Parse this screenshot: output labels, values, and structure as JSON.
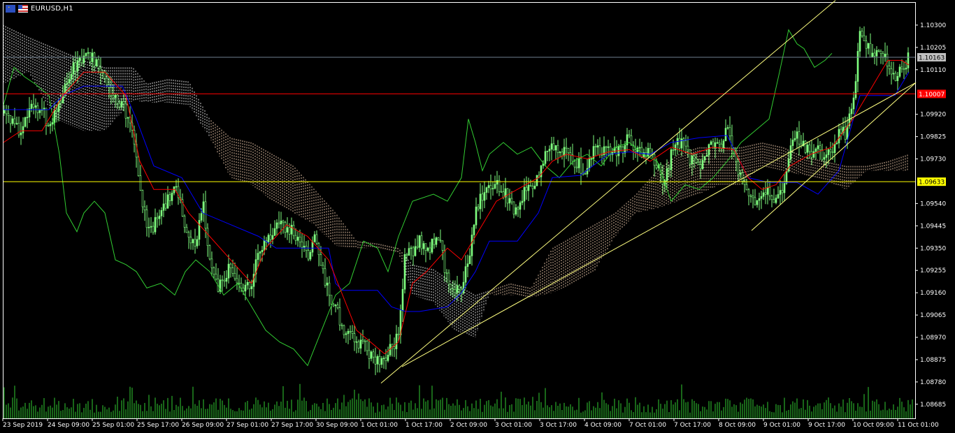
{
  "window": {
    "title": "EURUSD,H1"
  },
  "colors": {
    "background": "#000000",
    "frame": "#ffffff",
    "candles": "#7fff7f",
    "chikou": "#32cd32",
    "tenkan": "#ff0000",
    "kijun": "#0000ff",
    "cloud_bull": "#ffffff",
    "cloud_bear": "#ffdab9",
    "channel": "#ffff80",
    "volume": "#32cd32",
    "hline_bid": "#708090",
    "hline_red": "#ff0000",
    "hline_yellow": "#ffff00"
  },
  "chart_data": {
    "type": "candlestick",
    "symbol": "EURUSD",
    "timeframe": "H1",
    "ylim": [
      1.08625,
      1.10395
    ],
    "y_ticks": [
      "1.10300",
      "1.10205",
      "1.10110",
      "1.09920",
      "1.09825",
      "1.09730",
      "1.09540",
      "1.09445",
      "1.09350",
      "1.09255",
      "1.09160",
      "1.09065",
      "1.08970",
      "1.08875",
      "1.08780",
      "1.08685"
    ],
    "x_labels": [
      "23 Sep 2019",
      "24 Sep 09:00",
      "25 Sep 01:00",
      "25 Sep 17:00",
      "26 Sep 09:00",
      "27 Sep 01:00",
      "27 Sep 17:00",
      "30 Sep 09:00",
      "1 Oct 01:00",
      "1 Oct 17:00",
      "2 Oct 09:00",
      "3 Oct 01:00",
      "3 Oct 17:00",
      "4 Oct 09:00",
      "7 Oct 01:00",
      "7 Oct 17:00",
      "8 Oct 09:00",
      "9 Oct 01:00",
      "9 Oct 17:00",
      "10 Oct 09:00",
      "11 Oct 01:00"
    ],
    "close_series": [
      [
        0,
        1.0993
      ],
      [
        10,
        1.0992
      ],
      [
        20,
        1.0986
      ],
      [
        30,
        1.0985
      ],
      [
        40,
        1.0993
      ],
      [
        50,
        1.0996
      ],
      [
        60,
        1.0994
      ],
      [
        70,
        1.0987
      ],
      [
        80,
        1.0992
      ],
      [
        90,
        1.1002
      ],
      [
        100,
        1.1009
      ],
      [
        110,
        1.1014
      ],
      [
        120,
        1.1018
      ],
      [
        130,
        1.1016
      ],
      [
        140,
        1.1015
      ],
      [
        150,
        1.1008
      ],
      [
        160,
        1.1002
      ],
      [
        170,
        1.0998
      ],
      [
        180,
        1.0992
      ],
      [
        190,
        1.0983
      ],
      [
        200,
        1.0961
      ],
      [
        210,
        1.0946
      ],
      [
        220,
        1.0944
      ],
      [
        230,
        1.095
      ],
      [
        240,
        1.0955
      ],
      [
        250,
        1.0964
      ],
      [
        260,
        1.095
      ],
      [
        270,
        1.094
      ],
      [
        280,
        1.0935
      ],
      [
        290,
        1.0955
      ],
      [
        300,
        1.093
      ],
      [
        310,
        1.0918
      ],
      [
        320,
        1.092
      ],
      [
        330,
        1.0928
      ],
      [
        340,
        1.0922
      ],
      [
        350,
        1.0918
      ],
      [
        360,
        1.092
      ],
      [
        370,
        1.0932
      ],
      [
        380,
        1.0938
      ],
      [
        390,
        1.0942
      ],
      [
        400,
        1.0946
      ],
      [
        410,
        1.0942
      ],
      [
        420,
        1.0943
      ],
      [
        430,
        1.0934
      ],
      [
        440,
        1.0932
      ],
      [
        450,
        1.094
      ],
      [
        460,
        1.0928
      ],
      [
        470,
        1.0915
      ],
      [
        480,
        1.091
      ],
      [
        490,
        1.09
      ],
      [
        500,
        1.0898
      ],
      [
        510,
        1.0893
      ],
      [
        520,
        1.0894
      ],
      [
        530,
        1.089
      ],
      [
        540,
        1.0888
      ],
      [
        550,
        1.0888
      ],
      [
        560,
        1.0892
      ],
      [
        570,
        1.0897
      ],
      [
        580,
        1.0935
      ],
      [
        590,
        1.0933
      ],
      [
        600,
        1.0938
      ],
      [
        610,
        1.0932
      ],
      [
        620,
        1.0938
      ],
      [
        630,
        1.0936
      ],
      [
        640,
        1.092
      ],
      [
        650,
        1.0916
      ],
      [
        660,
        1.0918
      ],
      [
        670,
        1.093
      ],
      [
        680,
        1.095
      ],
      [
        690,
        1.0958
      ],
      [
        700,
        1.096
      ],
      [
        710,
        1.0962
      ],
      [
        720,
        1.0958
      ],
      [
        730,
        1.0956
      ],
      [
        740,
        1.0948
      ],
      [
        750,
        1.0958
      ],
      [
        760,
        1.0962
      ],
      [
        770,
        1.0965
      ],
      [
        780,
        1.0975
      ],
      [
        790,
        1.098
      ],
      [
        800,
        1.0975
      ],
      [
        810,
        1.0978
      ],
      [
        820,
        1.0972
      ],
      [
        830,
        1.097
      ],
      [
        840,
        1.0968
      ],
      [
        850,
        1.098
      ],
      [
        860,
        1.0975
      ],
      [
        870,
        1.0978
      ],
      [
        880,
        1.0975
      ],
      [
        890,
        1.0978
      ],
      [
        900,
        1.0982
      ],
      [
        910,
        1.0978
      ],
      [
        920,
        1.0976
      ],
      [
        930,
        1.0978
      ],
      [
        940,
        1.097
      ],
      [
        950,
        1.0962
      ],
      [
        960,
        1.0975
      ],
      [
        970,
        1.098
      ],
      [
        980,
        1.0978
      ],
      [
        990,
        1.0972
      ],
      [
        1000,
        1.097
      ],
      [
        1010,
        1.0976
      ],
      [
        1020,
        1.098
      ],
      [
        1030,
        1.0978
      ],
      [
        1040,
        1.0985
      ],
      [
        1050,
        1.0975
      ],
      [
        1060,
        1.0965
      ],
      [
        1070,
        1.0955
      ],
      [
        1080,
        1.0954
      ],
      [
        1090,
        1.0958
      ],
      [
        1100,
        1.096
      ],
      [
        1110,
        1.0956
      ],
      [
        1120,
        1.0962
      ],
      [
        1130,
        1.0978
      ],
      [
        1140,
        1.0982
      ],
      [
        1150,
        1.0978
      ],
      [
        1160,
        1.0976
      ],
      [
        1170,
        1.0978
      ],
      [
        1180,
        1.0972
      ],
      [
        1190,
        1.0976
      ],
      [
        1200,
        1.0985
      ],
      [
        1210,
        1.0984
      ],
      [
        1220,
        1.0995
      ],
      [
        1230,
        1.1028
      ],
      [
        1240,
        1.1022
      ],
      [
        1250,
        1.1015
      ],
      [
        1260,
        1.102
      ],
      [
        1270,
        1.1014
      ],
      [
        1280,
        1.1008
      ],
      [
        1290,
        1.101
      ],
      [
        1300,
        1.1017
      ]
    ],
    "tenkan_series": [
      [
        5,
        1.098
      ],
      [
        30,
        1.0985
      ],
      [
        60,
        1.0985
      ],
      [
        90,
        1.1
      ],
      [
        120,
        1.101
      ],
      [
        150,
        1.101
      ],
      [
        180,
        1.1
      ],
      [
        200,
        1.0972
      ],
      [
        220,
        1.096
      ],
      [
        250,
        1.096
      ],
      [
        270,
        1.095
      ],
      [
        300,
        1.094
      ],
      [
        330,
        1.093
      ],
      [
        360,
        1.092
      ],
      [
        380,
        1.0935
      ],
      [
        410,
        1.0945
      ],
      [
        440,
        1.094
      ],
      [
        470,
        1.093
      ],
      [
        490,
        1.0915
      ],
      [
        510,
        1.09
      ],
      [
        530,
        1.0895
      ],
      [
        550,
        1.089
      ],
      [
        570,
        1.0895
      ],
      [
        590,
        1.092
      ],
      [
        610,
        1.0925
      ],
      [
        640,
        1.0935
      ],
      [
        660,
        1.093
      ],
      [
        690,
        1.0945
      ],
      [
        710,
        1.0955
      ],
      [
        740,
        1.096
      ],
      [
        770,
        1.0965
      ],
      [
        790,
        1.0972
      ],
      [
        810,
        1.0975
      ],
      [
        840,
        1.0973
      ],
      [
        870,
        1.0976
      ],
      [
        900,
        1.0977
      ],
      [
        930,
        1.0972
      ],
      [
        960,
        1.0978
      ],
      [
        990,
        1.0975
      ],
      [
        1020,
        1.0978
      ],
      [
        1050,
        1.0977
      ],
      [
        1070,
        1.0965
      ],
      [
        1090,
        1.096
      ],
      [
        1110,
        1.0962
      ],
      [
        1130,
        1.097
      ],
      [
        1160,
        1.0975
      ],
      [
        1190,
        1.0978
      ],
      [
        1220,
        1.099
      ],
      [
        1250,
        1.1005
      ],
      [
        1270,
        1.1015
      ],
      [
        1290,
        1.1015
      ],
      [
        1300,
        1.1013
      ]
    ],
    "kijun_series": [
      [
        5,
        1.0994
      ],
      [
        70,
        1.0994
      ],
      [
        90,
        1.1
      ],
      [
        120,
        1.1004
      ],
      [
        175,
        1.1004
      ],
      [
        195,
        1.099
      ],
      [
        220,
        1.097
      ],
      [
        260,
        1.0965
      ],
      [
        290,
        1.095
      ],
      [
        330,
        1.0945
      ],
      [
        370,
        1.094
      ],
      [
        395,
        1.0935
      ],
      [
        470,
        1.0935
      ],
      [
        480,
        1.092
      ],
      [
        490,
        1.0917
      ],
      [
        540,
        1.0917
      ],
      [
        560,
        1.091
      ],
      [
        580,
        1.0908
      ],
      [
        600,
        1.0908
      ],
      [
        640,
        1.091
      ],
      [
        660,
        1.0916
      ],
      [
        680,
        1.0925
      ],
      [
        700,
        1.0938
      ],
      [
        740,
        1.0938
      ],
      [
        770,
        1.095
      ],
      [
        790,
        1.0965
      ],
      [
        830,
        1.0966
      ],
      [
        870,
        1.0975
      ],
      [
        900,
        1.0976
      ],
      [
        930,
        1.0975
      ],
      [
        960,
        1.098
      ],
      [
        1000,
        1.0982
      ],
      [
        1040,
        1.0983
      ],
      [
        1070,
        1.0965
      ],
      [
        1100,
        1.0963
      ],
      [
        1140,
        1.0963
      ],
      [
        1170,
        1.0958
      ],
      [
        1200,
        1.0968
      ],
      [
        1230,
        1.1
      ],
      [
        1280,
        1.1
      ],
      [
        1300,
        1.101
      ]
    ],
    "chikou_series": [
      [
        5,
        1.0996
      ],
      [
        20,
        1.1012
      ],
      [
        35,
        1.1008
      ],
      [
        50,
        1.1005
      ],
      [
        70,
        1.1
      ],
      [
        85,
        1.0975
      ],
      [
        95,
        1.095
      ],
      [
        110,
        1.0942
      ],
      [
        120,
        1.095
      ],
      [
        135,
        1.0955
      ],
      [
        150,
        1.095
      ],
      [
        165,
        1.093
      ],
      [
        180,
        1.0928
      ],
      [
        195,
        1.0925
      ],
      [
        210,
        1.0918
      ],
      [
        230,
        1.092
      ],
      [
        250,
        1.0915
      ],
      [
        265,
        1.0925
      ],
      [
        280,
        1.093
      ],
      [
        300,
        1.0925
      ],
      [
        320,
        1.0915
      ],
      [
        340,
        1.092
      ],
      [
        360,
        1.091
      ],
      [
        380,
        1.09
      ],
      [
        400,
        1.0895
      ],
      [
        420,
        1.0892
      ],
      [
        440,
        1.0885
      ],
      [
        460,
        1.09
      ],
      [
        480,
        1.0915
      ],
      [
        500,
        1.092
      ],
      [
        520,
        1.0938
      ],
      [
        540,
        1.0935
      ],
      [
        555,
        1.0925
      ],
      [
        570,
        1.094
      ],
      [
        590,
        1.0955
      ],
      [
        620,
        1.0958
      ],
      [
        640,
        1.0955
      ],
      [
        660,
        1.0965
      ],
      [
        670,
        1.099
      ],
      [
        680,
        1.098
      ],
      [
        690,
        1.0968
      ],
      [
        700,
        1.0975
      ],
      [
        720,
        1.098
      ],
      [
        740,
        1.0975
      ],
      [
        760,
        1.0978
      ],
      [
        780,
        1.097
      ],
      [
        800,
        1.0965
      ],
      [
        820,
        1.0972
      ],
      [
        840,
        1.0975
      ],
      [
        860,
        1.097
      ],
      [
        880,
        1.0978
      ],
      [
        900,
        1.098
      ],
      [
        920,
        1.0975
      ],
      [
        940,
        1.0972
      ],
      [
        960,
        1.0955
      ],
      [
        980,
        1.0962
      ],
      [
        1000,
        1.096
      ],
      [
        1020,
        1.0965
      ],
      [
        1040,
        1.0972
      ],
      [
        1060,
        1.098
      ],
      [
        1080,
        1.0985
      ],
      [
        1100,
        1.099
      ],
      [
        1115,
        1.101
      ],
      [
        1128,
        1.1028
      ],
      [
        1140,
        1.1022
      ],
      [
        1150,
        1.102
      ],
      [
        1165,
        1.1012
      ],
      [
        1180,
        1.1015
      ],
      [
        1190,
        1.1018
      ]
    ],
    "cloud": [
      [
        5,
        1.103,
        1.1005
      ],
      [
        40,
        1.1025,
        1.101
      ],
      [
        80,
        1.102,
        1.099
      ],
      [
        120,
        1.1015,
        1.0985
      ],
      [
        150,
        1.1012,
        1.0985
      ],
      [
        190,
        1.1012,
        1.0998
      ],
      [
        210,
        1.1005,
        1.0997
      ],
      [
        240,
        1.1007,
        1.0997
      ],
      [
        270,
        1.1006,
        1.0996
      ],
      [
        300,
        1.099,
        1.0982
      ],
      [
        330,
        1.0982,
        1.0965
      ],
      [
        360,
        1.098,
        1.0962
      ],
      [
        390,
        1.0975,
        1.0955
      ],
      [
        420,
        1.097,
        1.095
      ],
      [
        450,
        1.096,
        1.0945
      ],
      [
        480,
        1.095,
        1.0936
      ],
      [
        510,
        1.0938,
        1.0935
      ],
      [
        540,
        1.0937,
        1.0935
      ],
      [
        570,
        1.0935,
        1.0933
      ],
      [
        590,
        1.0928,
        1.0915
      ],
      [
        620,
        1.0926,
        1.0912
      ],
      [
        650,
        1.092,
        1.09
      ],
      [
        680,
        1.0915,
        1.0897
      ],
      [
        700,
        1.0917,
        1.0915
      ],
      [
        730,
        1.092,
        1.0915
      ],
      [
        760,
        1.0918,
        1.0914
      ],
      [
        790,
        1.0935,
        1.0916
      ],
      [
        820,
        1.094,
        1.092
      ],
      [
        850,
        1.0945,
        1.0925
      ],
      [
        880,
        1.095,
        1.094
      ],
      [
        910,
        1.0958,
        1.095
      ],
      [
        940,
        1.0968,
        1.0952
      ],
      [
        970,
        1.0975,
        1.0955
      ],
      [
        1000,
        1.0978,
        1.0958
      ],
      [
        1030,
        1.0978,
        1.0962
      ],
      [
        1060,
        1.0978,
        1.0962
      ],
      [
        1090,
        1.098,
        1.097
      ],
      [
        1120,
        1.0978,
        1.0968
      ],
      [
        1150,
        1.0974,
        1.0966
      ],
      [
        1180,
        1.0972,
        1.0964
      ],
      [
        1210,
        1.097,
        1.096
      ],
      [
        1240,
        1.097,
        1.0968
      ],
      [
        1270,
        1.0972,
        1.0968
      ],
      [
        1300,
        1.0975,
        1.0968
      ]
    ],
    "channel_lines": [
      {
        "from": [
          545,
          1.08775
        ],
        "to": [
          1195,
          1.10405
        ]
      },
      {
        "from": [
          575,
          1.08845
        ],
        "to": [
          1310,
          1.10055
        ]
      },
      {
        "from": [
          1075,
          1.09425
        ],
        "to": [
          1310,
          1.10055
        ]
      }
    ],
    "horizontal_lines": [
      {
        "price": 1.10163,
        "label": "1.10163",
        "role": "bid"
      },
      {
        "price": 1.10007,
        "label": "1.10007",
        "role": "red"
      },
      {
        "price": 1.09633,
        "label": "1.09633",
        "role": "yellow"
      }
    ],
    "volume_ylim": [
      0,
      100
    ],
    "grid": false
  }
}
